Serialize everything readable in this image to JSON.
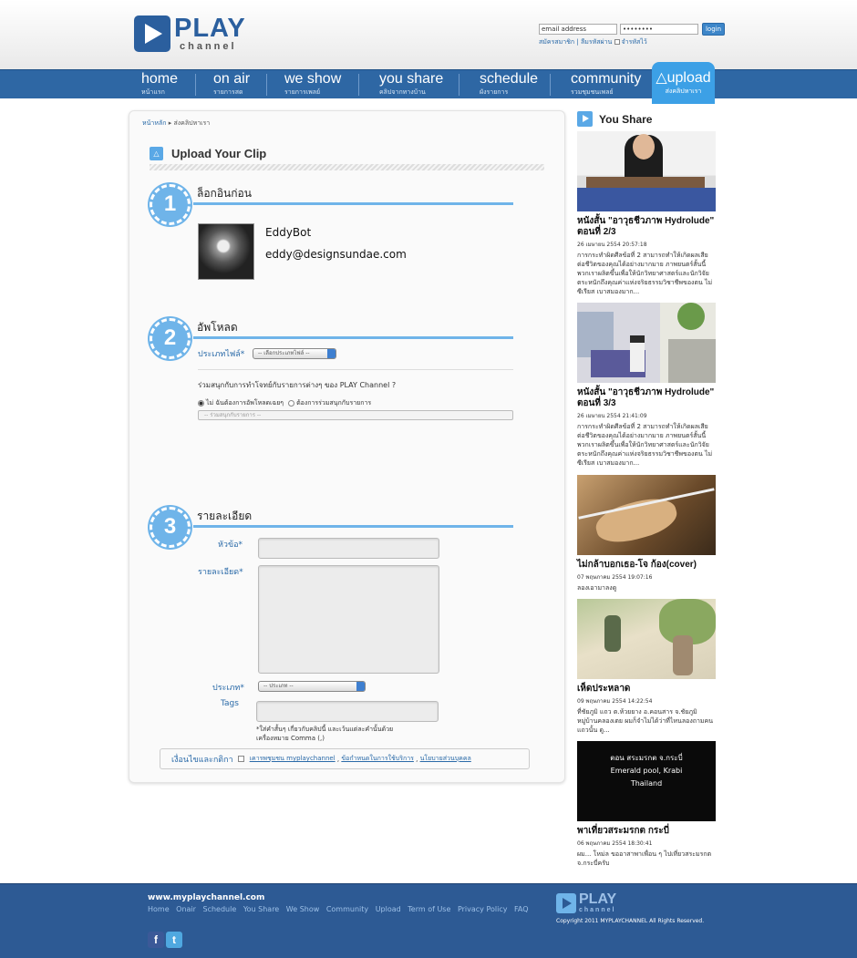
{
  "header": {
    "logo_big": "PLAY",
    "logo_small": "channel",
    "email_placeholder": "email address",
    "password_value": "••••••••",
    "login_label": "login",
    "register_link": "สมัครสมาชิก",
    "forgot_link": "ลืมรหัสผ่าน",
    "remember_label": "จำรหัสไว้"
  },
  "nav": {
    "items": [
      {
        "label": "home",
        "sub": "หน้าแรก"
      },
      {
        "label": "on air",
        "sub": "รายการสด"
      },
      {
        "label": "we show",
        "sub": "รายการเพลย์"
      },
      {
        "label": "you share",
        "sub": "คลิปจากทางบ้าน"
      },
      {
        "label": "schedule",
        "sub": "ผังรายการ"
      },
      {
        "label": "community",
        "sub": "รวมชุมชนเพลย์"
      },
      {
        "label": "upload",
        "sub": "ส่งคลิปหาเรา"
      }
    ]
  },
  "breadcrumb": {
    "home": "หน้าหลัก",
    "current": "ส่งคลิปหาเรา"
  },
  "upload": {
    "title": "Upload Your Clip",
    "step1": {
      "num": "1",
      "title": "ล็อกอินก่อน",
      "user_name": "EddyBot",
      "user_email": "eddy@designsundae.com"
    },
    "step2": {
      "num": "2",
      "title": "อัพโหลด",
      "file_type_label": "ประเภทไฟล์*",
      "file_type_value": "-- เลือกประเภทไฟล์ --",
      "question": "ร่วมสนุกกับการทำโจทย์กับรายการต่างๆ ของ PLAY Channel ?",
      "radio_no": "ไม่ ฉันต้องการอัพโหลดเฉยๆ",
      "radio_yes": "ต้องการร่วมสนุกกับรายการ",
      "program_placeholder": "-- ร่วมสนุกกับรายการ --"
    },
    "step3": {
      "num": "3",
      "title": "รายละเอียด",
      "topic_label": "หัวข้อ*",
      "detail_label": "รายละเอียด*",
      "category_label": "ประเภท*",
      "category_value": "-- ประเภท --",
      "tags_label": "Tags",
      "tags_hint": "*ใส่คำสั้นๆ เกี่ยวกับคลิปนี้ และเว้นแต่ละคำนั้นด้วย เครื่องหมาย Comma (,)"
    },
    "terms": {
      "label": "เงื่อนไขและกติกา",
      "link1": "เคารพชุมชน myplaychannel",
      "link2": "ข้อกำหนดในการใช้บริการ",
      "link3": "นโยบายส่วนบุคคล"
    }
  },
  "sidebar": {
    "title": "You Share",
    "videos": [
      {
        "title": "หนังสั้น \"อาวุธชีวภาพ Hydrolude\" ตอนที่ 2/3",
        "date": "26 เมษายน 2554 20:57:18",
        "desc": "การกระทำผิดศีลข้อที่ 2 สามารถทำให้เกิดผลเสียต่อชีวิตของคุณได้อย่างมากมาย ภาพยนตร์สั้นนี้ พวกเราผลิตขึ้นเพื่อให้นักวิทยาศาสตร์และนักวิจัยตระหนักถึงคุณค่าแห่งจริยธรรมวิชาชีพของตน ไม่ซีเรียส เบาสมองมาก..."
      },
      {
        "title": "หนังสั้น \"อาวุธชีวภาพ Hydrolude\" ตอนที่ 3/3",
        "date": "26 เมษายน 2554 21:41:09",
        "desc": "การกระทำผิดศีลข้อที่ 2 สามารถทำให้เกิดผลเสียต่อชีวิตของคุณได้อย่างมากมาย ภาพยนตร์สั้นนี้ พวกเราผลิตขึ้นเพื่อให้นักวิทยาศาสตร์และนักวิจัยตระหนักถึงคุณค่าแห่งจริยธรรมวิชาชีพของตน ไม่ซีเรียส เบาสมองมาก..."
      },
      {
        "title": "ไม่กล้าบอกเธอ-โจ ก้อง(cover)",
        "date": "07 พฤษภาคม 2554 19:07:16",
        "desc": "ลองเอามาลงดู"
      },
      {
        "title": "เห็ดประหลาด",
        "date": "09 พฤษภาคม 2554 14:22:54",
        "desc": "ที่ชัยภูมิ แถว ต.ห้วยยาง อ.คอนสาร จ.ชัยภูมิ หมู่บ้านคลองเตย ผมก็จำไม่ได้ว่าที่ไหนลองถามคนแถวนั้น ดู..."
      },
      {
        "title": "พาเที่ยวสระมรกต กระบี่",
        "date": "06 พฤษภาคม 2554 18:30:41",
        "desc": "ผม... โหม่ล ขออาสาพาเพื่อน ๆ ไปเที่ยวสระมรกต จ.กระบี่ครับ",
        "thumb_line1": "ตอน สระมรกต จ.กระบี่",
        "thumb_line2": "Emerald pool, Krabi",
        "thumb_line3": "Thailand"
      }
    ]
  },
  "footer": {
    "site": "www.myplaychannel.com",
    "links": [
      "Home",
      "Onair",
      "Schedule",
      "You Share",
      "We Show",
      "Community",
      "Upload",
      "Term of Use",
      "Privacy Policy",
      "FAQ"
    ],
    "copyright": "Copyright 2011 MYPLAYCHANNEL All Rights Reserved."
  }
}
